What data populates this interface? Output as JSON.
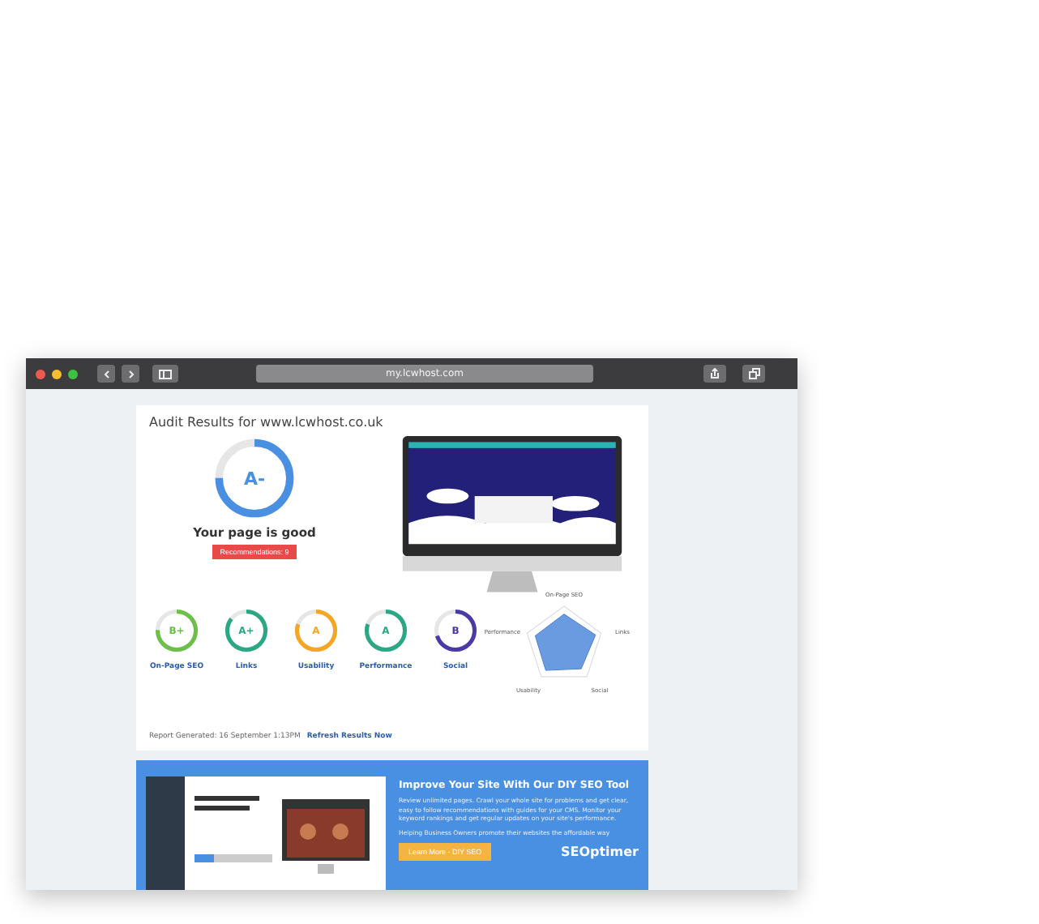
{
  "browser": {
    "url": "my.lcwhost.com"
  },
  "audit": {
    "title": "Audit Results for www.lcwhost.co.uk",
    "grade": "A-",
    "level": 0.75,
    "verdict": "Your page is good",
    "recommendations": "Recommendations: 9",
    "scores": [
      {
        "grade": "B+",
        "label": "On-Page SEO",
        "level": 0.75,
        "color": "#6cc04a"
      },
      {
        "grade": "A+",
        "label": "Links",
        "level": 0.85,
        "color": "#2aa784"
      },
      {
        "grade": "A",
        "label": "Usability",
        "level": 0.8,
        "color": "#f5a623"
      },
      {
        "grade": "A",
        "label": "Performance",
        "level": 0.8,
        "color": "#2aa784"
      },
      {
        "grade": "B",
        "label": "Social",
        "level": 0.7,
        "color": "#4a3aa8"
      }
    ],
    "radar_labels": [
      "On-Page SEO",
      "Links",
      "Social",
      "Usability",
      "Performance"
    ],
    "report": "Report Generated: 16 September 1:13PM",
    "refresh": "Refresh Results Now"
  },
  "promo": {
    "title": "Improve Your Site With Our DIY SEO Tool",
    "body": "Review unlimited pages. Crawl your whole site for problems and get clear, easy to follow recommendations with guides for your CMS. Monitor your keyword rankings and get regular updates on your site's performance.",
    "tagline": "Helping Business Owners promote their websites the affordable way",
    "button": "Learn More - DIY SEO",
    "brand": "SEOptimer"
  }
}
